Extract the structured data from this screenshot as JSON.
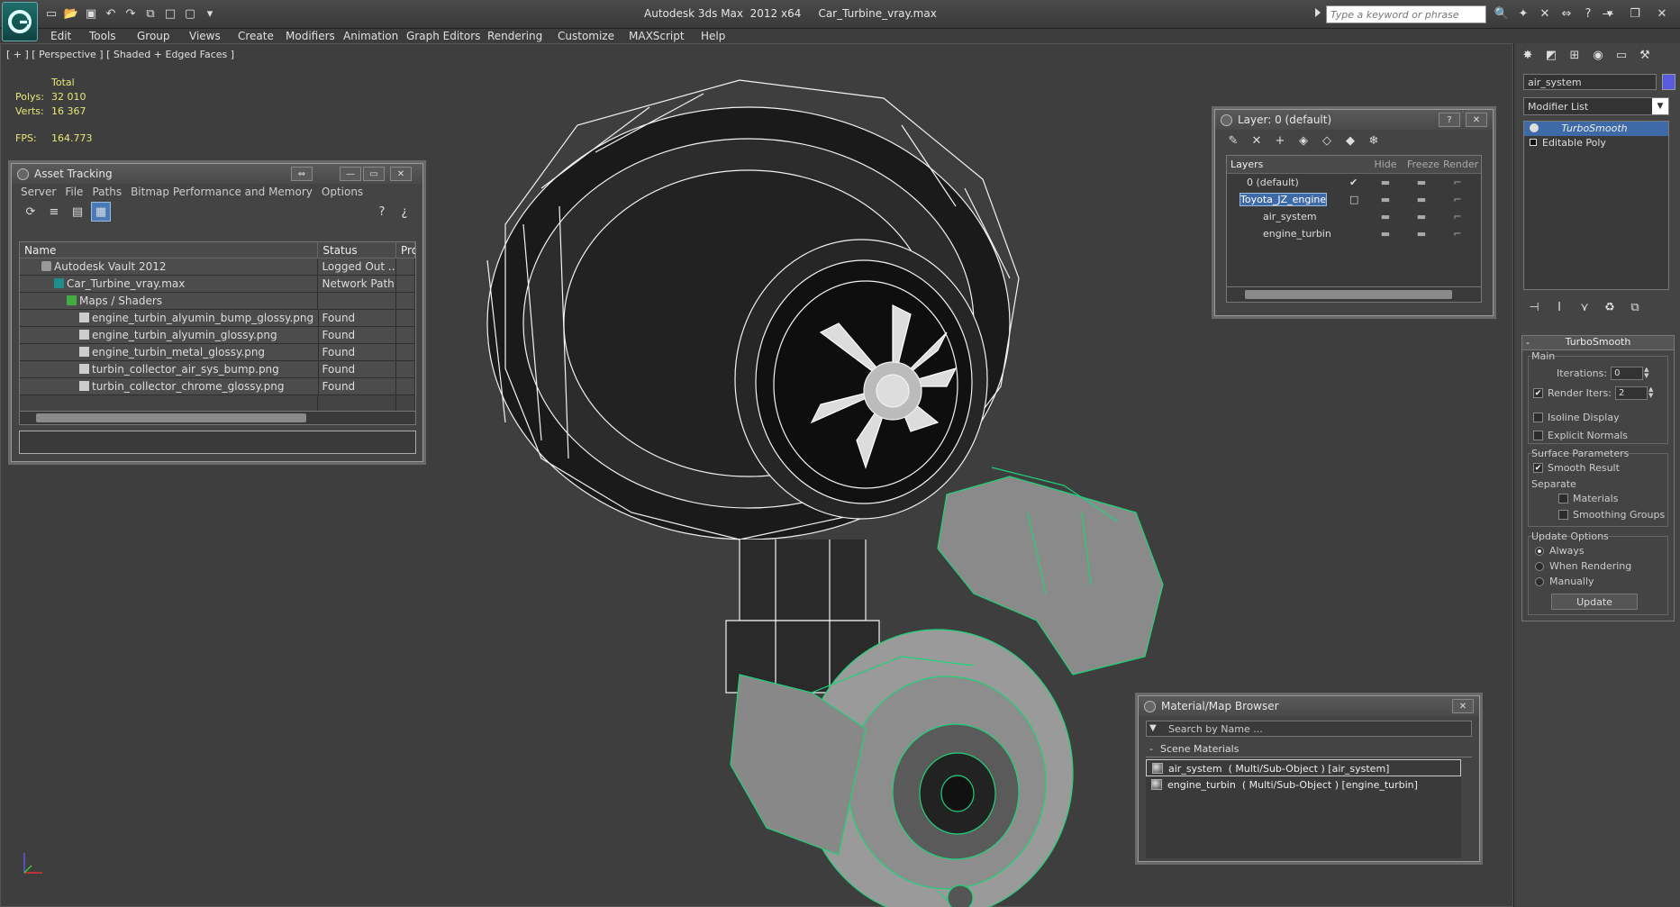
{
  "titlebar": {
    "app_name": "Autodesk 3ds Max  2012 x64",
    "file_name": "Car_Turbine_vray.max",
    "search_placeholder": "Type a keyword or phrase"
  },
  "menu": [
    "Edit",
    "Tools",
    "Group",
    "Views",
    "Create",
    "Modifiers",
    "Animation",
    "Graph Editors",
    "Rendering",
    "Customize",
    "MAXScript",
    "Help"
  ],
  "viewport": {
    "label": "[ + ] [ Perspective ] [ Shaded + Edged Faces ]",
    "stats_header": "Total",
    "polys_label": "Polys:",
    "polys_value": "32 010",
    "verts_label": "Verts:",
    "verts_value": "16 367",
    "fps_label": "FPS:",
    "fps_value": "164.773"
  },
  "asset_tracking": {
    "title": "Asset Tracking",
    "menu": [
      "Server",
      "File",
      "Paths",
      "Bitmap Performance and Memory",
      "Options"
    ],
    "columns": [
      "Name",
      "Status",
      "Pro"
    ],
    "rows": [
      {
        "name": "Autodesk Vault 2012",
        "status": "Logged Out ..."
      },
      {
        "name": "Car_Turbine_vray.max",
        "status": "Network Path"
      },
      {
        "name": "Maps / Shaders",
        "status": ""
      },
      {
        "name": "engine_turbin_alyumin_bump_glossy.png",
        "status": "Found"
      },
      {
        "name": "engine_turbin_alyumin_glossy.png",
        "status": "Found"
      },
      {
        "name": "engine_turbin_metal_glossy.png",
        "status": "Found"
      },
      {
        "name": "turbin_collector_air_sys_bump.png",
        "status": "Found"
      },
      {
        "name": "turbin_collector_chrome_glossy.png",
        "status": "Found"
      }
    ]
  },
  "layers": {
    "title": "Layer: 0 (default)",
    "columns": [
      "Layers",
      "Hide",
      "Freeze",
      "Render"
    ],
    "rows": [
      {
        "name": "0 (default)"
      },
      {
        "name": "Toyota_JZ_engine"
      },
      {
        "name": "air_system"
      },
      {
        "name": "engine_turbin"
      }
    ]
  },
  "material_browser": {
    "title": "Material/Map Browser",
    "search_placeholder": "Search by Name ...",
    "section": "Scene Materials",
    "items": [
      "air_system  ( Multi/Sub-Object ) [air_system]",
      "engine_turbin  ( Multi/Sub-Object ) [engine_turbin]"
    ]
  },
  "command_panel": {
    "object_name": "air_system",
    "object_color": "#5a5ae0",
    "modifier_list": "Modifier List",
    "stack": [
      "TurboSmooth",
      "Editable Poly"
    ],
    "rollout_title": "TurboSmooth",
    "main_label": "Main",
    "iterations_label": "Iterations:",
    "iterations_value": "0",
    "render_iters_label": "Render Iters:",
    "render_iters_value": "2",
    "isoline_label": "Isoline Display",
    "explicit_label": "Explicit Normals",
    "surface_label": "Surface Parameters",
    "smooth_label": "Smooth Result",
    "separate_label": "Separate",
    "materials_label": "Materials",
    "smoothing_label": "Smoothing Groups",
    "update_options_label": "Update Options",
    "always_label": "Always",
    "when_rendering_label": "When Rendering",
    "manually_label": "Manually",
    "update_button": "Update"
  }
}
